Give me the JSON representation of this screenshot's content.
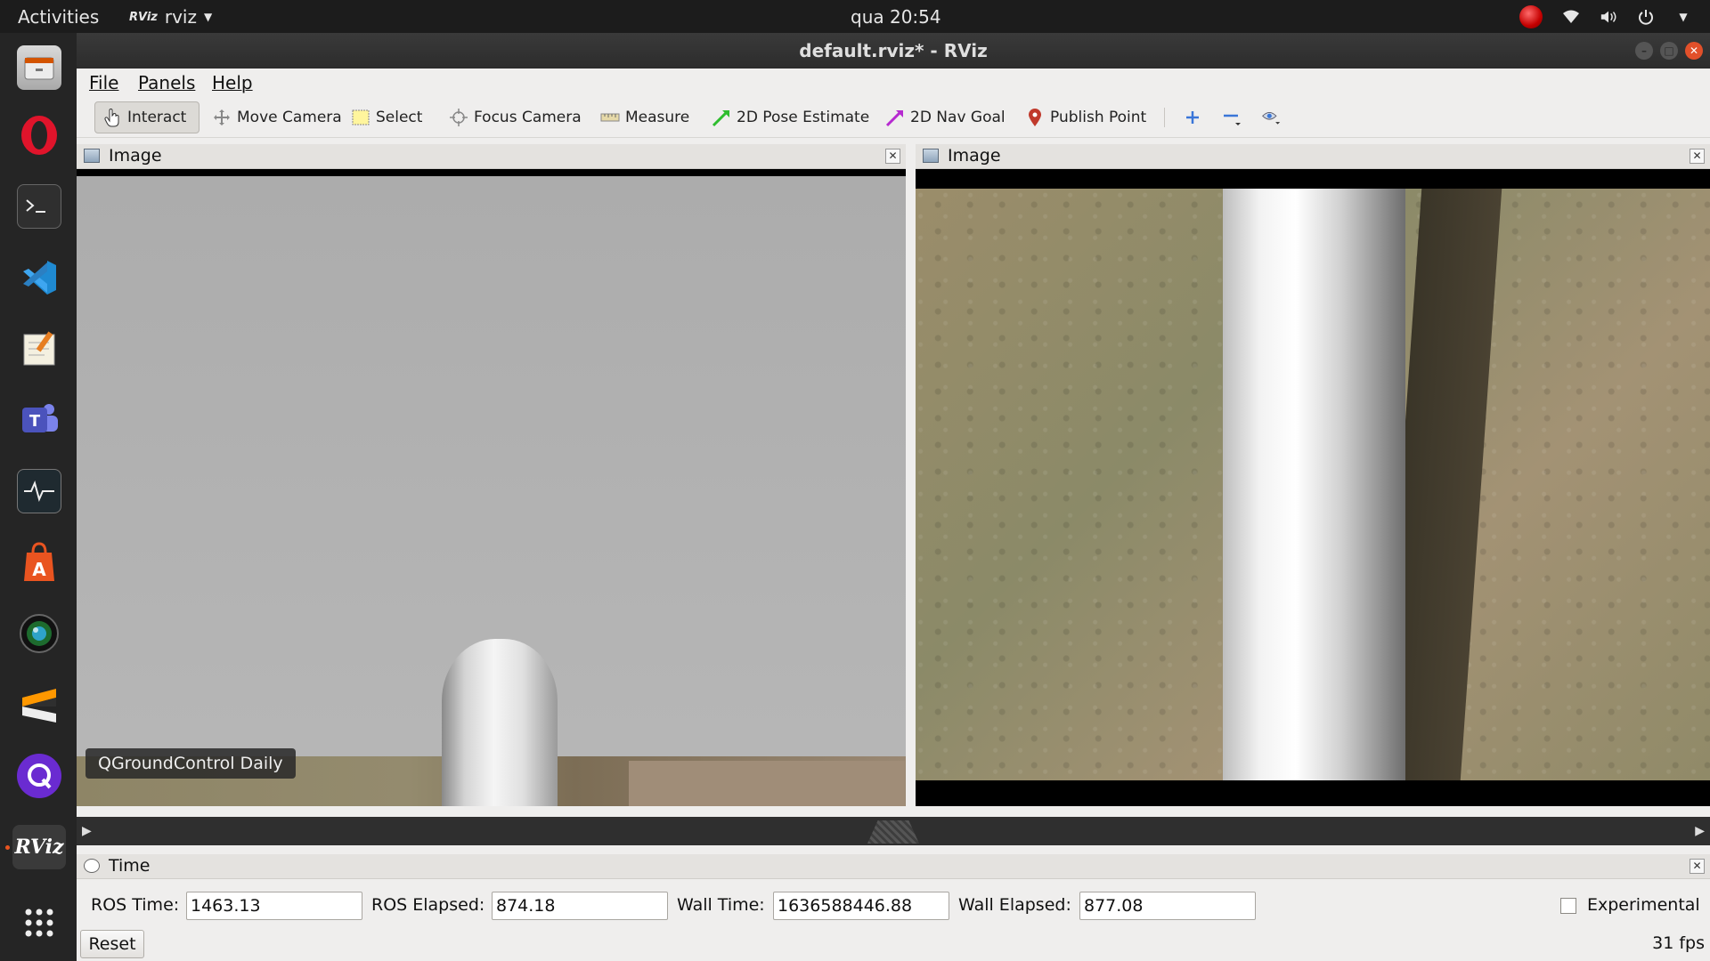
{
  "topbar": {
    "activities": "Activities",
    "app_name": "rviz",
    "app_icon_text": "RViz",
    "clock": "qua 20:54"
  },
  "dock": {
    "items": [
      {
        "name": "files",
        "icon": "files-icon"
      },
      {
        "name": "opera",
        "icon": "opera-icon"
      },
      {
        "name": "terminal",
        "icon": "terminal-icon"
      },
      {
        "name": "vscode",
        "icon": "vscode-icon"
      },
      {
        "name": "text-editor",
        "icon": "text-editor-icon"
      },
      {
        "name": "teams",
        "icon": "teams-icon"
      },
      {
        "name": "system-monitor",
        "icon": "system-monitor-icon"
      },
      {
        "name": "software-center",
        "icon": "software-center-icon"
      },
      {
        "name": "camera",
        "icon": "camera-icon"
      },
      {
        "name": "sublime",
        "icon": "sublime-icon"
      },
      {
        "name": "qgroundcontrol",
        "icon": "qgroundcontrol-icon"
      },
      {
        "name": "rviz",
        "icon": "rviz-icon"
      },
      {
        "name": "show-apps",
        "icon": "app-grid-icon"
      }
    ],
    "rviz_label": "RViz"
  },
  "window": {
    "title": "default.rviz* - RViz"
  },
  "menubar": {
    "file": "File",
    "panels": "Panels",
    "help": "Help"
  },
  "toolbar": {
    "interact": "Interact",
    "move_camera": "Move Camera",
    "select": "Select",
    "focus_camera": "Focus Camera",
    "measure": "Measure",
    "pose_estimate": "2D Pose Estimate",
    "nav_goal": "2D Nav Goal",
    "publish_point": "Publish Point",
    "accent_green": "#2ebd2e",
    "accent_purple": "#b62ad0",
    "accent_red": "#c0392b",
    "accent_blue": "#3a76d8"
  },
  "panels": {
    "left_title": "Image",
    "right_title": "Image"
  },
  "left_view": {
    "tooltip": "QGroundControl Daily"
  },
  "time": {
    "title": "Time",
    "ros_time_label": "ROS Time:",
    "ros_time": "1463.13",
    "ros_elapsed_label": "ROS Elapsed:",
    "ros_elapsed": "874.18",
    "wall_time_label": "Wall Time:",
    "wall_time": "1636588446.88",
    "wall_elapsed_label": "Wall Elapsed:",
    "wall_elapsed": "877.08",
    "experimental_label": "Experimental",
    "experimental_checked": false,
    "reset": "Reset",
    "fps": "31 fps"
  }
}
